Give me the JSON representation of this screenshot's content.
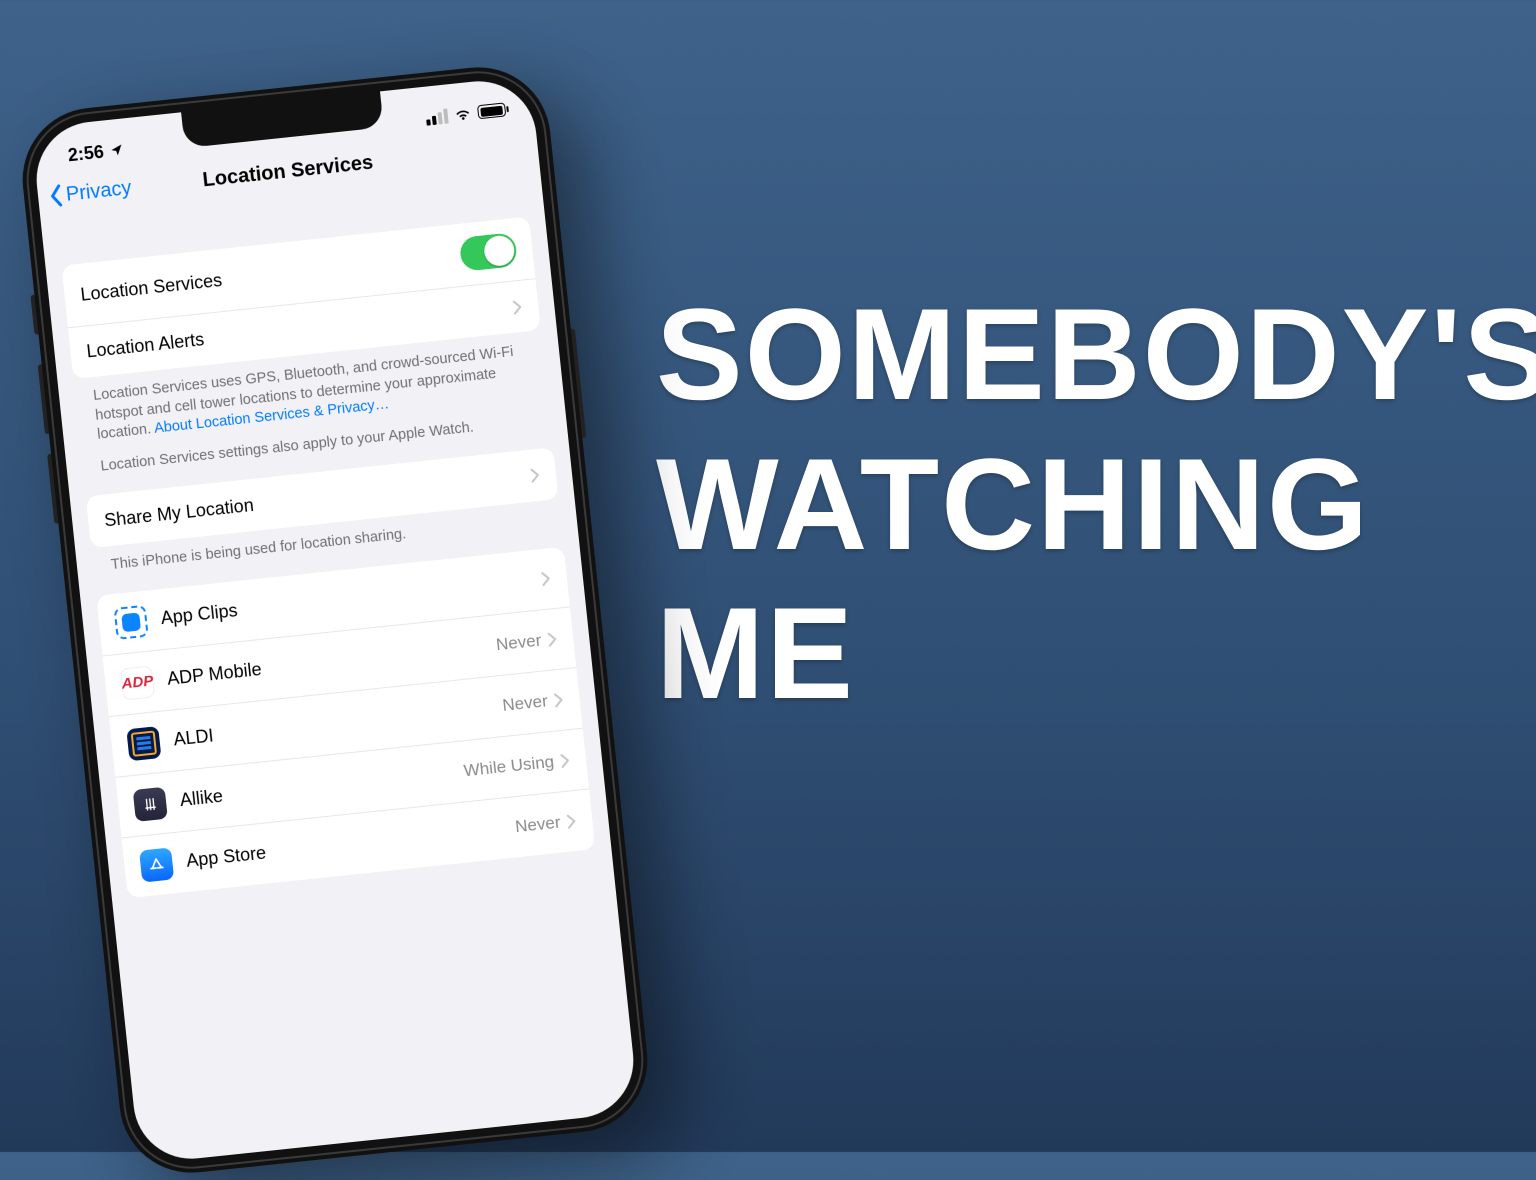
{
  "headline": {
    "line1": "SOMEBODY'S",
    "line2": "WATCHING",
    "line3": "ME"
  },
  "status": {
    "time": "2:56"
  },
  "nav": {
    "back_label": "Privacy",
    "title": "Location Services"
  },
  "group1": {
    "location_services_label": "Location Services",
    "location_alerts_label": "Location Alerts"
  },
  "footer1": {
    "text": "Location Services uses GPS, Bluetooth, and crowd-sourced Wi-Fi hotspot and cell tower locations to determine your approximate location. ",
    "link": "About Location Services & Privacy…",
    "text2": "Location Services settings also apply to your Apple Watch."
  },
  "group2": {
    "share_label": "Share My Location"
  },
  "footer2": {
    "text": "This iPhone is being used for location sharing."
  },
  "apps": {
    "0": {
      "name": "App Clips",
      "value": ""
    },
    "1": {
      "name": "ADP Mobile",
      "value": "Never"
    },
    "2": {
      "name": "ALDI",
      "value": "Never"
    },
    "3": {
      "name": "Allike",
      "value": "While Using"
    },
    "4": {
      "name": "App Store",
      "value": "Never"
    }
  }
}
